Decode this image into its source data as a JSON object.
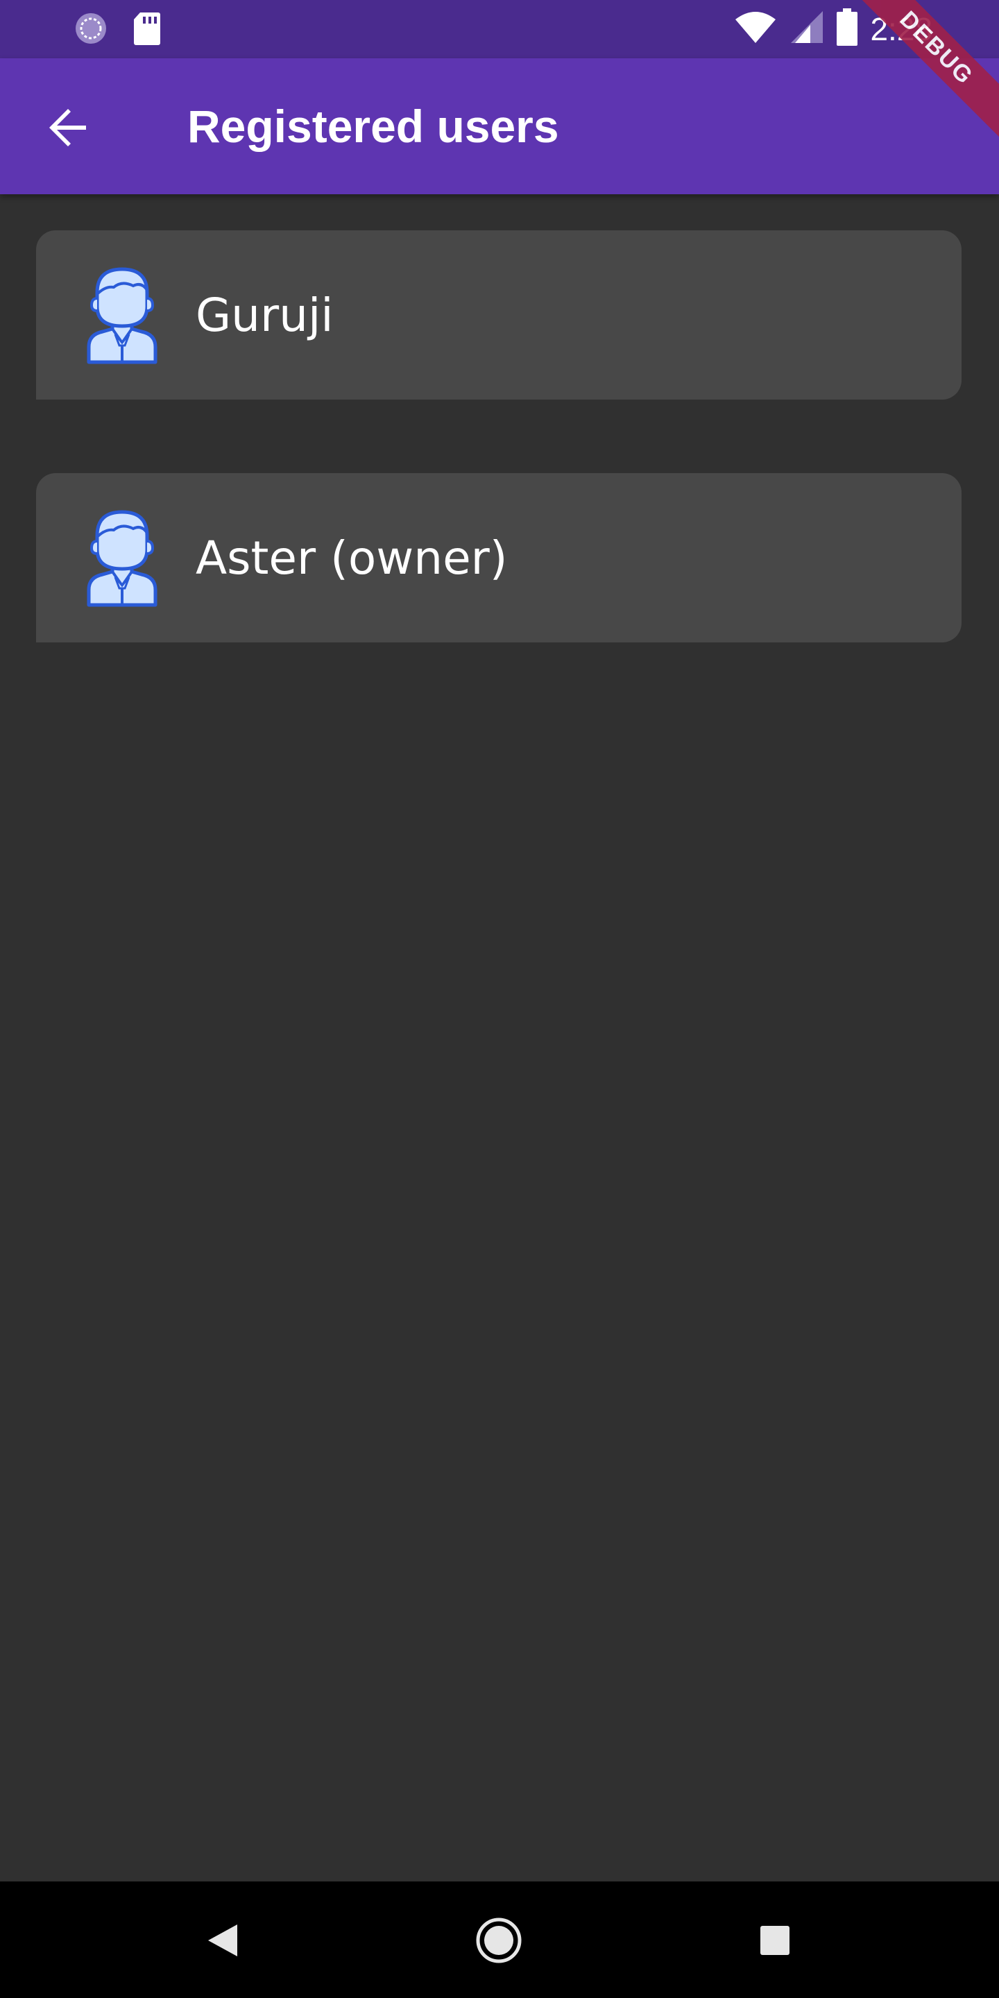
{
  "status_bar": {
    "time": "2:28",
    "icons": [
      "sync-icon",
      "sd-card-icon",
      "wifi-icon",
      "signal-icon",
      "battery-icon"
    ]
  },
  "app_bar": {
    "title": "Registered users",
    "back_icon": "arrow-back-icon",
    "background": "#5e35b1"
  },
  "debug_banner": "DEBUG",
  "users": [
    {
      "name": "Guruji",
      "icon": "user-avatar-icon"
    },
    {
      "name": "Aster (owner)",
      "icon": "user-avatar-icon"
    }
  ],
  "nav_bar": {
    "buttons": [
      "back-triangle-icon",
      "home-circle-icon",
      "recents-square-icon"
    ]
  },
  "colors": {
    "status_bar": "#4a2b8e",
    "background": "#303030",
    "card": "#484848",
    "avatar_stroke": "#2a5bd7",
    "avatar_fill": "#cfe3ff"
  }
}
